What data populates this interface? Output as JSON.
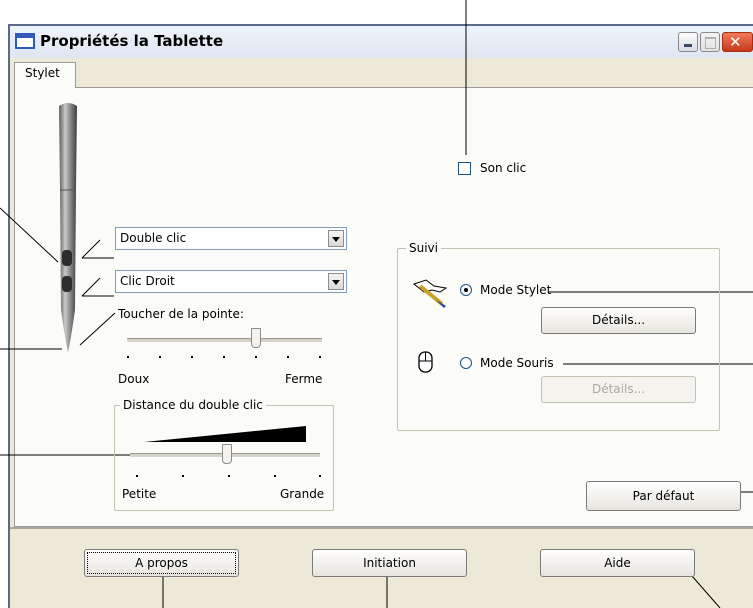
{
  "window": {
    "title": "Propriétés la Tablette"
  },
  "tabs": [
    {
      "label": "Stylet"
    }
  ],
  "stylus": {
    "upper_button_value": "Double clic",
    "lower_button_value": "Clic Droit",
    "tip_feel": {
      "label": "Toucher de la pointe:",
      "min_label": "Doux",
      "max_label": "Ferme",
      "level": 0.75
    },
    "double_click_distance": {
      "title": "Distance du double clic",
      "min_label": "Petite",
      "max_label": "Grande",
      "level": 0.5
    }
  },
  "sound": {
    "label": "Son clic",
    "checked": false
  },
  "tracking": {
    "title": "Suivi",
    "pen_mode_label": "Mode Stylet",
    "mouse_mode_label": "Mode Souris",
    "selected": "pen",
    "details_label": "Détails...",
    "details_disabled_label": "Détails..."
  },
  "buttons": {
    "default_label": "Par défaut",
    "about_label": "A propos",
    "tutorial_label": "Initiation",
    "help_label": "Aide"
  }
}
